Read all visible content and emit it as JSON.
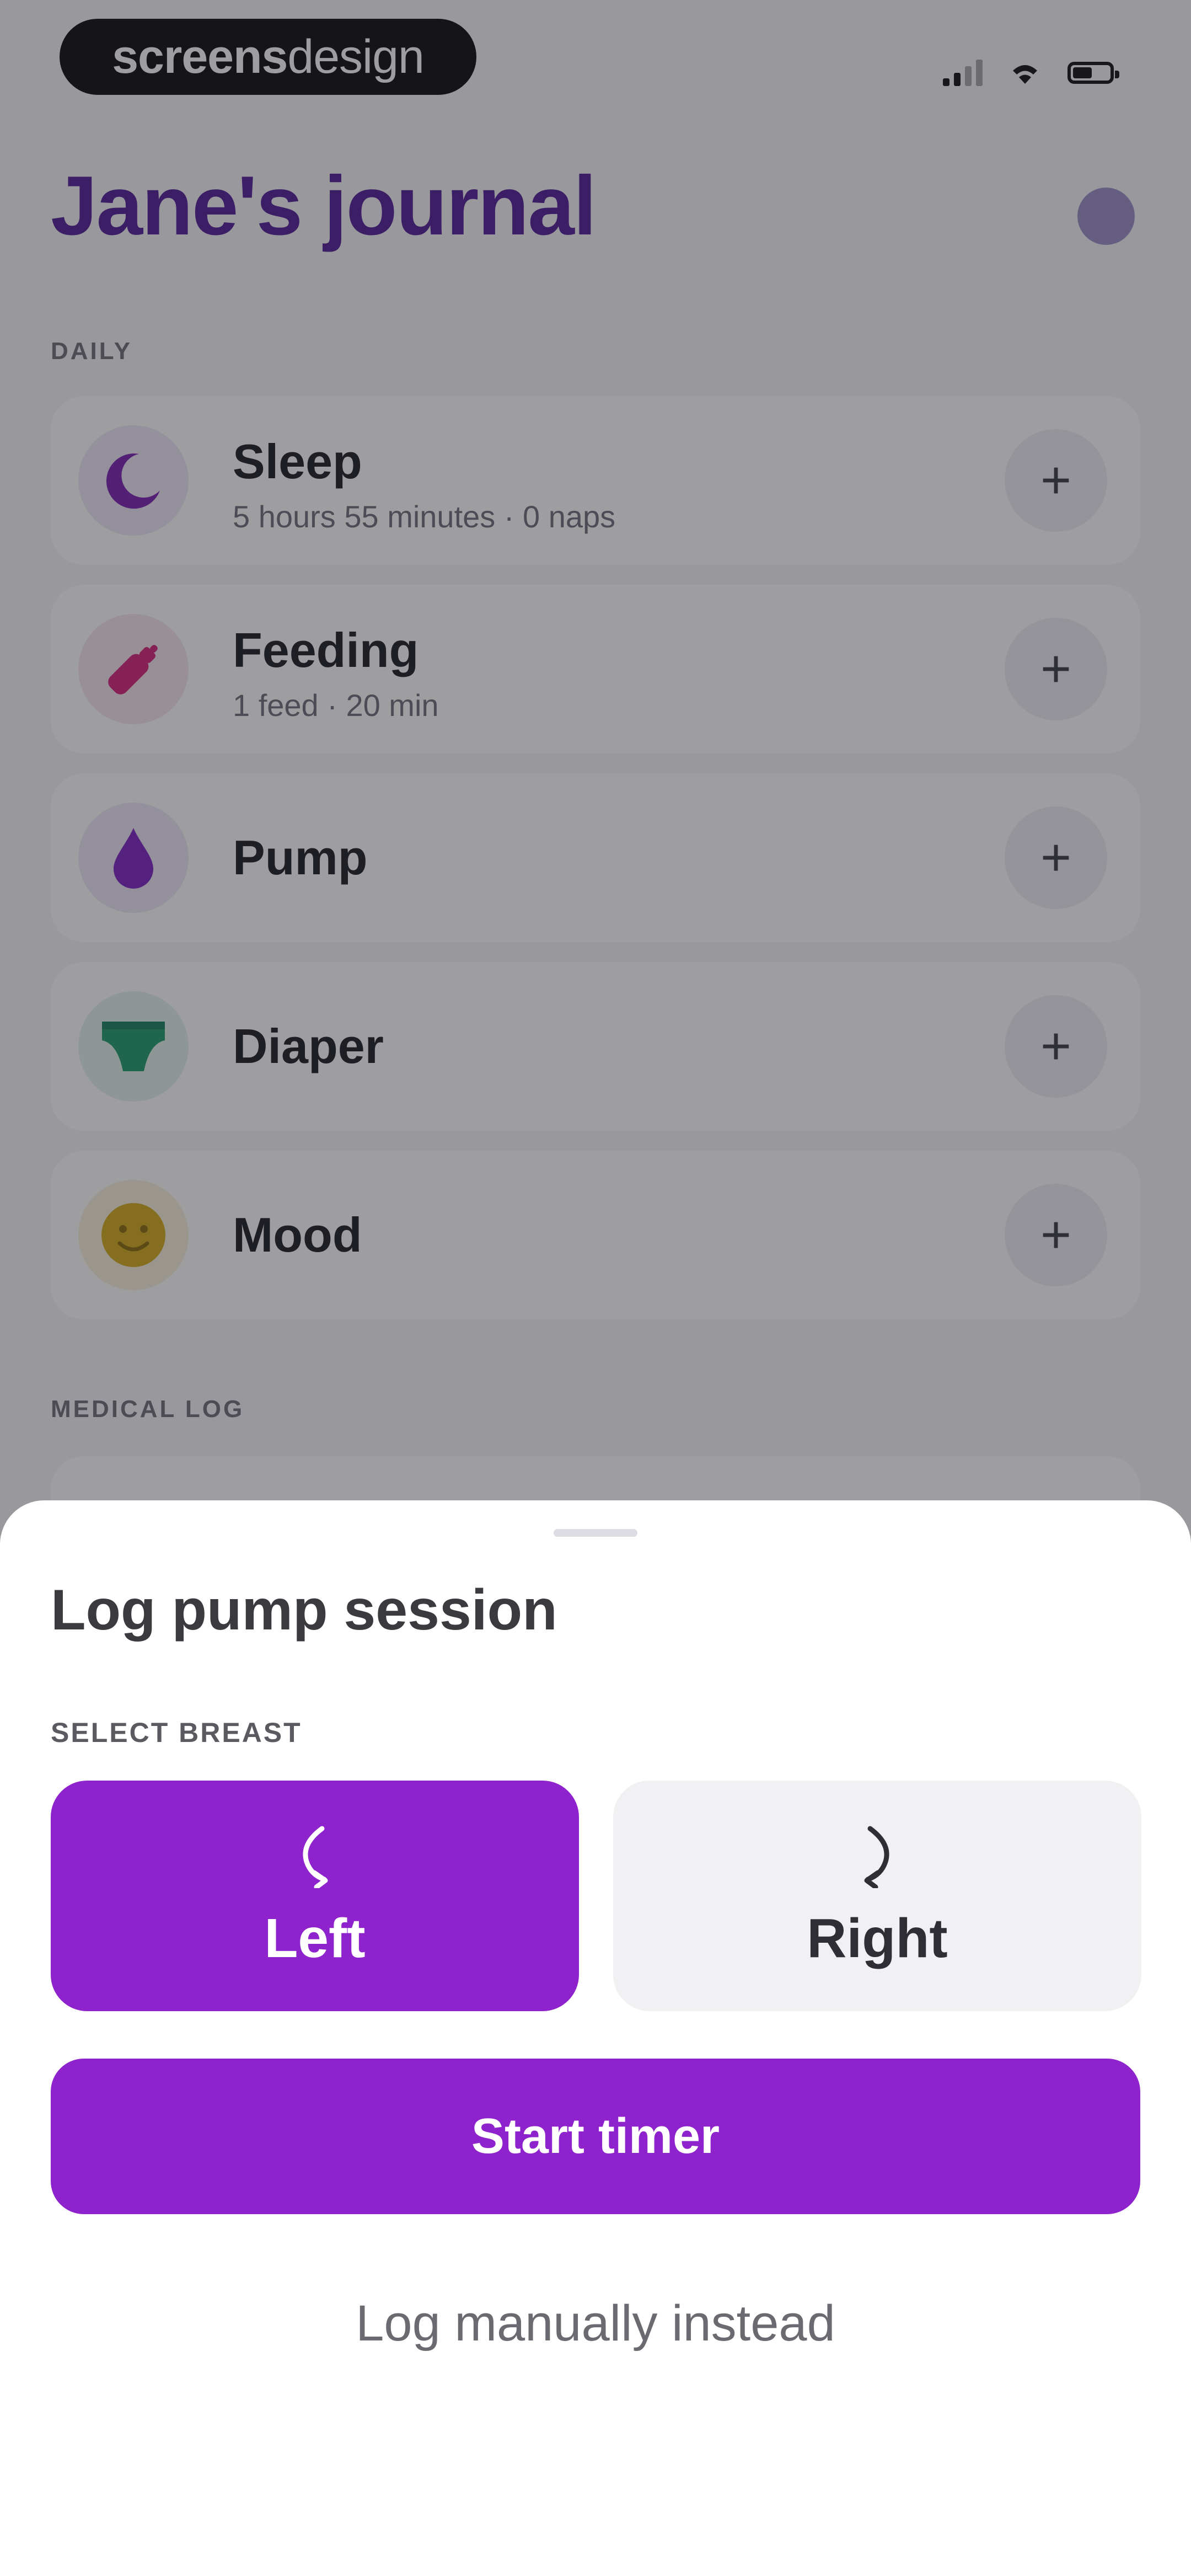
{
  "status_bar": {
    "brand_bold": "screens",
    "brand_light": "design"
  },
  "header": {
    "title": "Jane's journal"
  },
  "daily": {
    "section_label": "DAILY",
    "items": [
      {
        "title": "Sleep",
        "subtitle": "5 hours 55 minutes · 0 naps",
        "icon": "moon-icon",
        "color": "#7a1fb0"
      },
      {
        "title": "Feeding",
        "subtitle": "1 feed · 20 min",
        "icon": "bottle-icon",
        "color": "#d4207a"
      },
      {
        "title": "Pump",
        "subtitle": "",
        "icon": "drop-icon",
        "color": "#7b22c0"
      },
      {
        "title": "Diaper",
        "subtitle": "",
        "icon": "diaper-icon",
        "color": "#1f9a6c"
      },
      {
        "title": "Mood",
        "subtitle": "",
        "icon": "smiley-icon",
        "color": "#d4aa1c"
      }
    ],
    "add_symbol": "+"
  },
  "medical": {
    "section_label": "MEDICAL LOG"
  },
  "sheet": {
    "title": "Log pump session",
    "select_label": "SELECT BREAST",
    "left_label": "Left",
    "right_label": "Right",
    "selected": "Left",
    "start_label": "Start timer",
    "manual_label": "Log manually instead"
  },
  "colors": {
    "accent": "#8e22cc",
    "title": "#4f1c94"
  }
}
